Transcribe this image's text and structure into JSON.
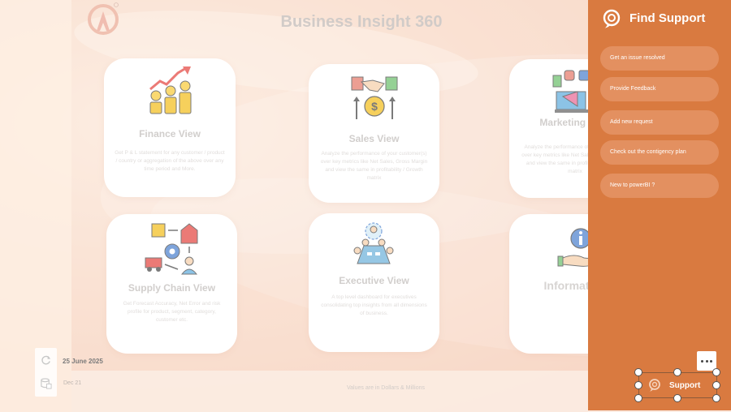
{
  "title": "Business Insight 360",
  "cards": [
    {
      "title": "Finance View",
      "desc": "Get P & L statement for any customer / product / country or aggregation of the above over any time period and More.",
      "icon": "finance-growth-icon"
    },
    {
      "title": "Sales View",
      "desc": "Analyze the performance of your customer(s) over key metrics like Net Sales, Gross Margin and view the same in profitability / Growth matrix",
      "icon": "handshake-deal-icon"
    },
    {
      "title": "Marketing View",
      "desc": "Analyze the performance of your product(s) over key metrics like Net Sales, Gross Margin and view the same in profitability / Growth matrix",
      "icon": "marketing-icon"
    },
    {
      "title": "Supply Chain View",
      "desc": "Get Forecast Accuracy, Net Error and risk profile for product, segment, category, customer etc.",
      "icon": "supply-chain-icon"
    },
    {
      "title": "Executive View",
      "desc": "A top level dashboard for executives consolidating top insights from all dimensions of business.",
      "icon": "executive-meeting-icon"
    },
    {
      "title": "Information",
      "desc": "",
      "icon": "information-hand-icon"
    }
  ],
  "support": {
    "title": "Find Support",
    "items": [
      "Get an issue resolved",
      "Provide Feedback",
      "Add new request",
      "Check out the contigency plan",
      "New to powerBI ?"
    ],
    "button_label": "Support"
  },
  "date": {
    "main": "25 June 2025",
    "sub": "Dec 21"
  },
  "footnote": "Values are in Dollars & Millions",
  "colors": {
    "accent": "#d97a40",
    "panel_button": "#e39060",
    "title_gray": "#b8b0ab"
  }
}
